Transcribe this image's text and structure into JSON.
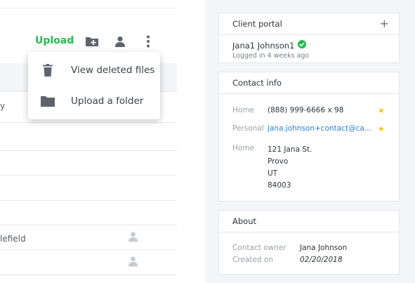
{
  "toolbar": {
    "upload_label": "Upload"
  },
  "table": {
    "rows": [
      {
        "text": "y",
        "has_person": false
      },
      {
        "text": "",
        "has_person": false
      },
      {
        "text": "",
        "has_person": false
      },
      {
        "text": "",
        "has_person": false
      },
      {
        "text": "",
        "has_person": true
      },
      {
        "text": "lefield",
        "has_person": true
      }
    ]
  },
  "dropdown": {
    "items": [
      {
        "label": "View deleted files",
        "icon": "trash-icon"
      },
      {
        "label": "Upload a folder",
        "icon": "folder-icon"
      }
    ]
  },
  "client_portal": {
    "title": "Client portal",
    "name": "Jana1 Johnson1",
    "status": "Logged in 4 weeks ago"
  },
  "contact_info": {
    "title": "Contact info",
    "phone_type": "Home",
    "phone": "(888) 999-6666 x 98",
    "email_type": "Personal",
    "email": "jana.johnson+contact@ca...",
    "address_type": "Home",
    "address_lines": [
      "121 Jana St.",
      "Provo",
      "UT",
      "84003"
    ]
  },
  "about": {
    "title": "About",
    "owner_label": "Contact owner",
    "owner": "Jana Johnson",
    "created_label": "Created on",
    "created": "02/20/2018"
  },
  "colors": {
    "accent_green": "#1fbf4e",
    "link_blue": "#2d7fd6",
    "star_yellow": "#f3c515"
  }
}
